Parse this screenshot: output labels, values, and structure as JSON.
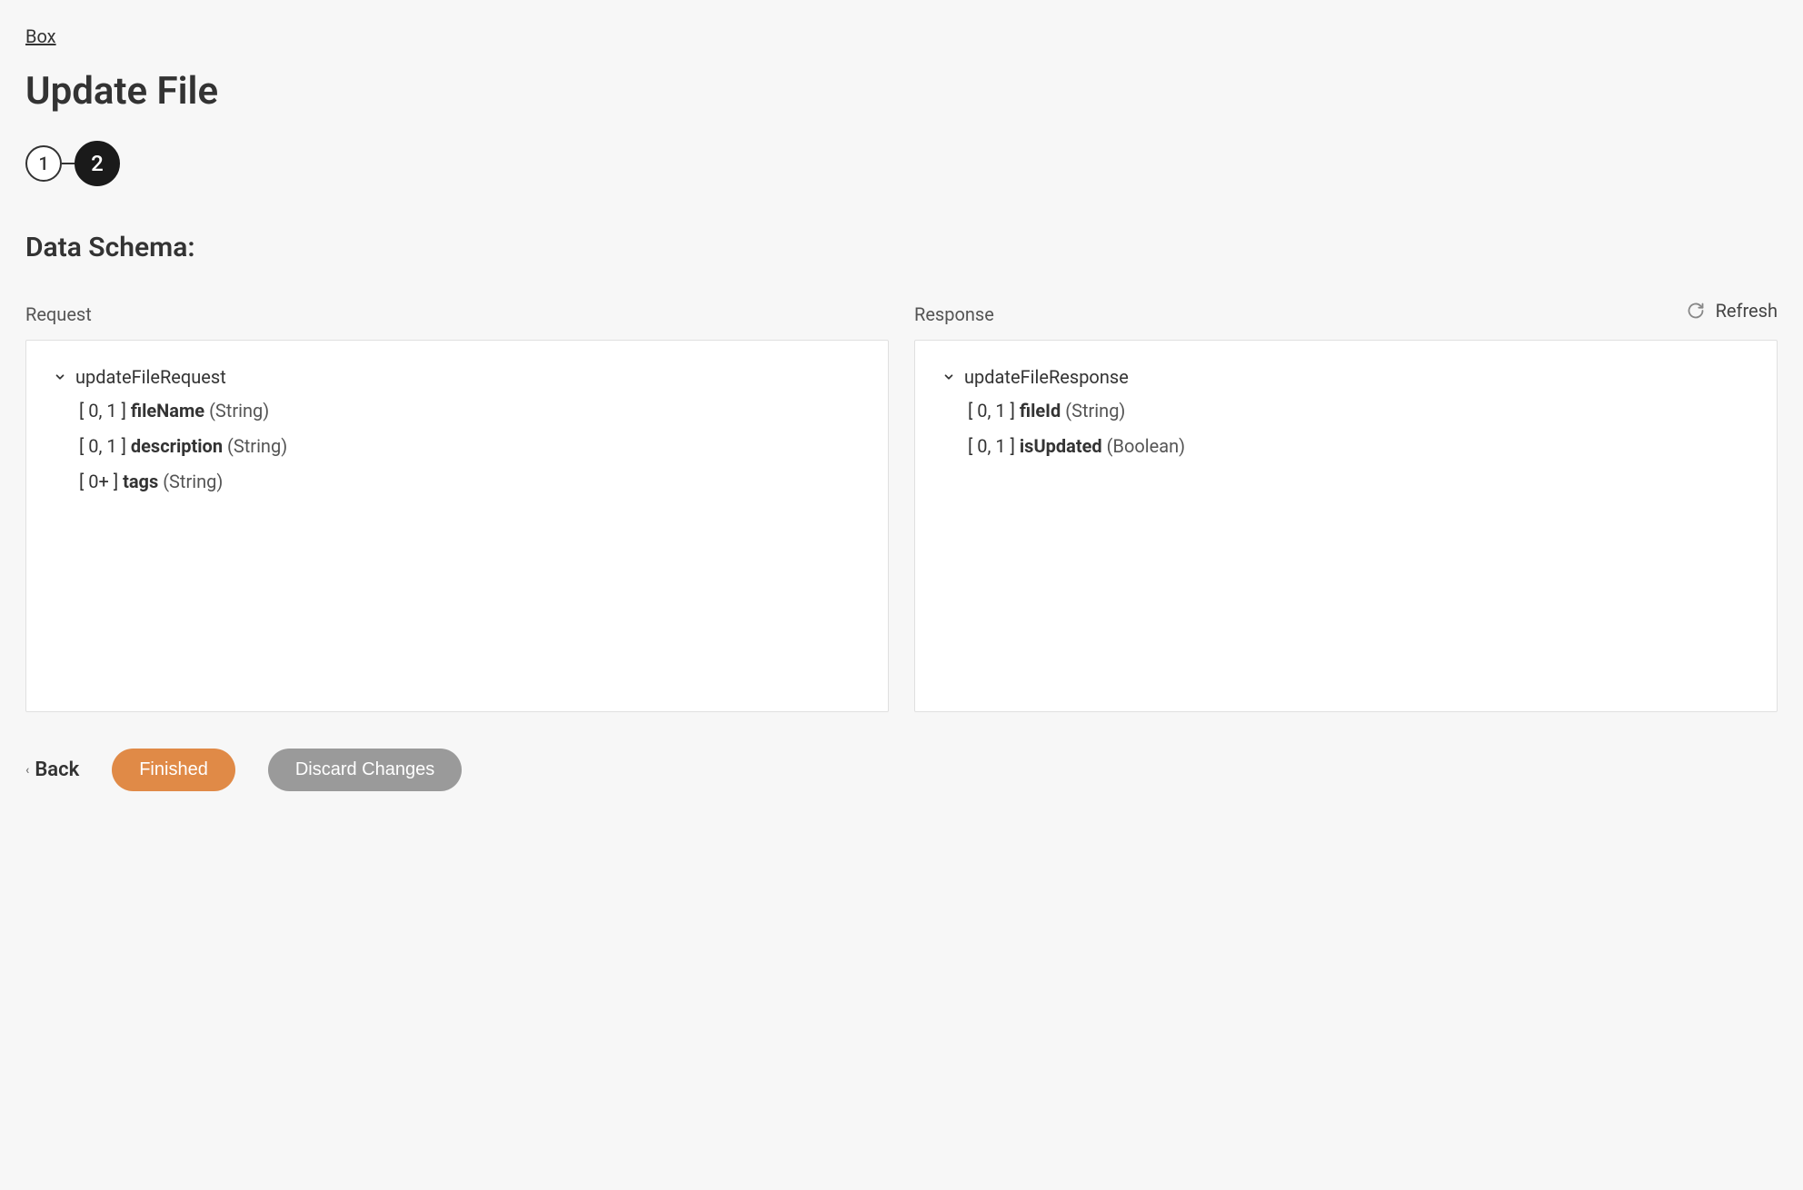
{
  "breadcrumb": {
    "label": "Box"
  },
  "page": {
    "title": "Update File",
    "section_title": "Data Schema:"
  },
  "stepper": {
    "step1": "1",
    "step2": "2"
  },
  "refresh": {
    "label": "Refresh"
  },
  "request": {
    "label": "Request",
    "root": "updateFileRequest",
    "fields": [
      {
        "cardinality": "[ 0, 1 ]",
        "name": "fileName",
        "type": "(String)"
      },
      {
        "cardinality": "[ 0, 1 ]",
        "name": "description",
        "type": "(String)"
      },
      {
        "cardinality": "[ 0+ ]",
        "name": "tags",
        "type": "(String)"
      }
    ]
  },
  "response": {
    "label": "Response",
    "root": "updateFileResponse",
    "fields": [
      {
        "cardinality": "[ 0, 1 ]",
        "name": "fileId",
        "type": "(String)"
      },
      {
        "cardinality": "[ 0, 1 ]",
        "name": "isUpdated",
        "type": "(Boolean)"
      }
    ]
  },
  "footer": {
    "back": "Back",
    "finished": "Finished",
    "discard": "Discard Changes"
  }
}
